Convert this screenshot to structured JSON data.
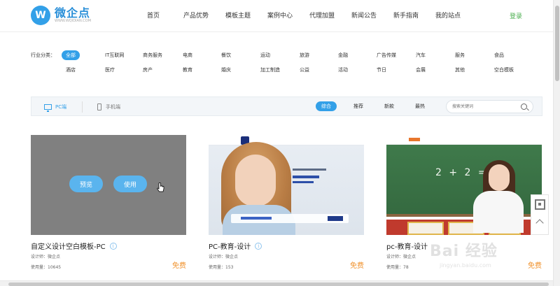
{
  "header": {
    "logo_mark": "W",
    "logo_name": "微企点",
    "logo_url": "WWW.WQIDIAN.COM",
    "nav": [
      "首页",
      "产品优势",
      "模板主题",
      "案例中心",
      "代理加盟",
      "新闻公告",
      "新手指南",
      "我的站点"
    ],
    "login": "登录"
  },
  "filter": {
    "label": "行业分类：",
    "row1": [
      "全部",
      "IT互联网",
      "商务服务",
      "电商",
      "餐饮",
      "运动",
      "旅游",
      "金融",
      "广告传媒",
      "汽车",
      "服务",
      "食品"
    ],
    "row2": [
      "酒店",
      "医疗",
      "房产",
      "教育",
      "婚庆",
      "加工制造",
      "公益",
      "活动",
      "节日",
      "会展",
      "其他",
      "空白模板"
    ]
  },
  "toolbar": {
    "pc_label": "PC端",
    "mobile_label": "手机端",
    "sort": [
      "综合",
      "推荐",
      "新款",
      "最热"
    ],
    "search_placeholder": "搜索关键词"
  },
  "cards": [
    {
      "title": "自定义设计空白模板-PC",
      "designer": "设计师：微企点",
      "usage": "使用量：10645",
      "price": "免费",
      "preview_label": "预览",
      "use_label": "使用"
    },
    {
      "title": "PC-教育-设计",
      "designer": "设计师：微企点",
      "usage": "使用量：153",
      "price": "免费"
    },
    {
      "title": "pc-教育-设计",
      "designer": "设计师：微企点",
      "usage": "使用量：78",
      "price": "免费"
    }
  ],
  "thumb3_text": "2 + 2 = ?",
  "watermark": {
    "big": "Bai 经验",
    "small": "jingyan.baidu.com"
  },
  "colors": {
    "accent": "#33a0e8",
    "price": "#f0922d",
    "login": "#4caf50"
  }
}
